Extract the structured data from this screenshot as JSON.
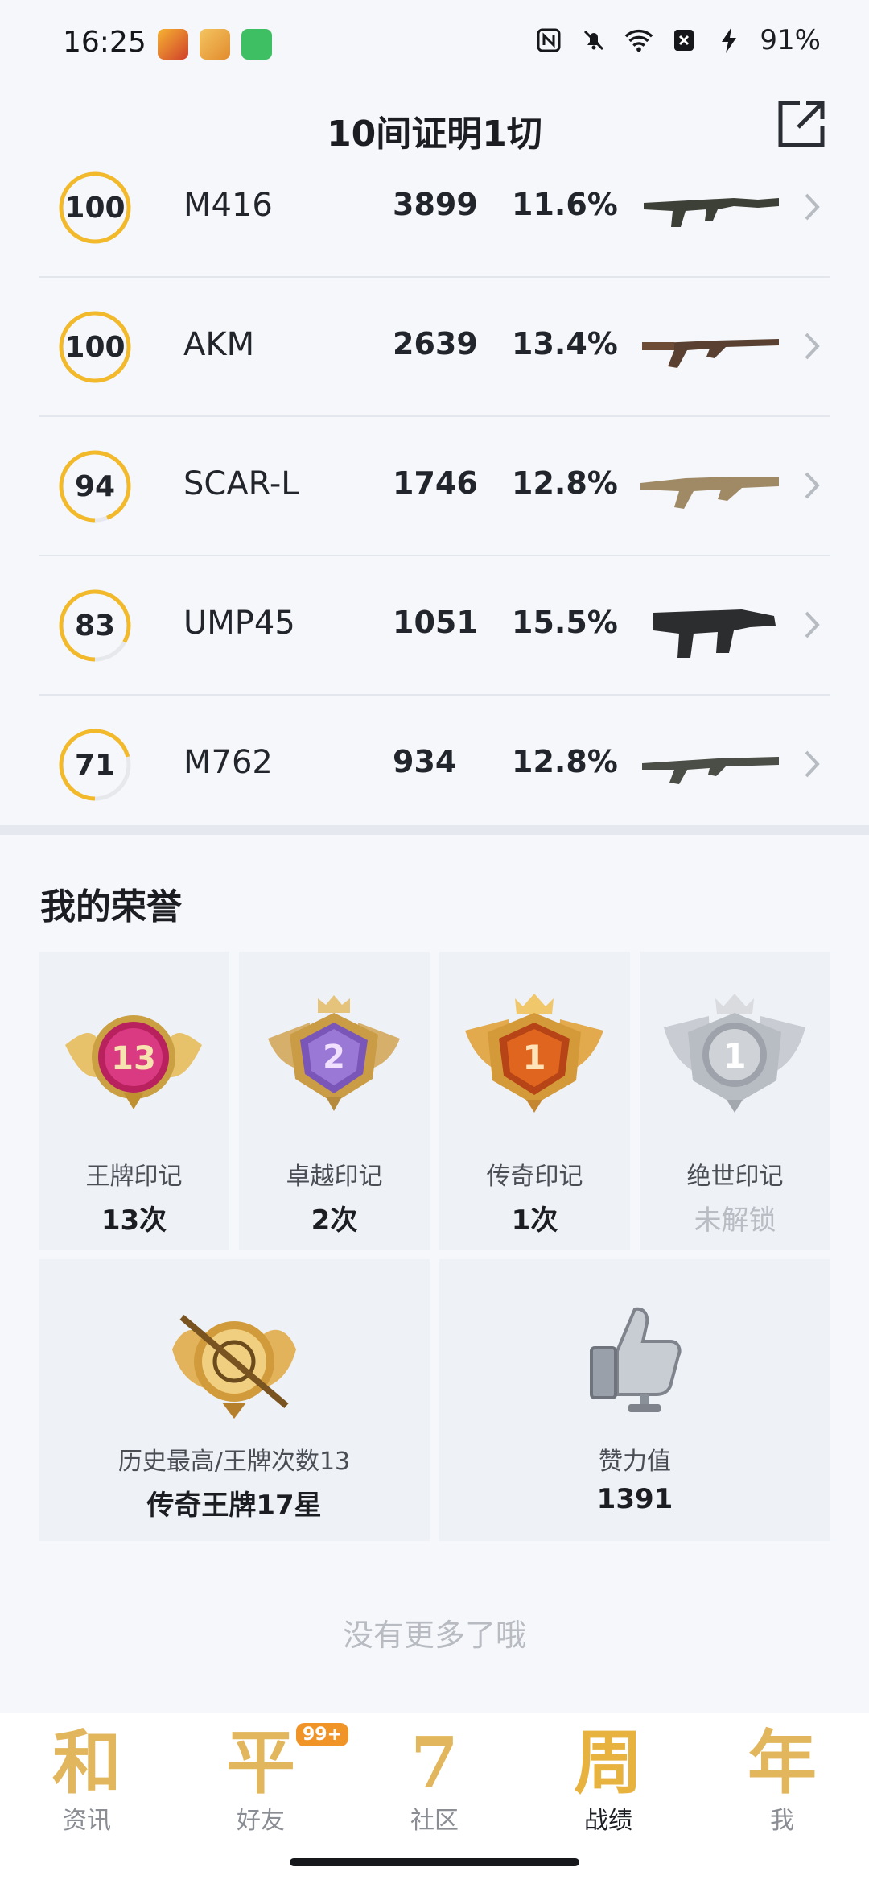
{
  "status": {
    "time": "16:25",
    "battery": "91%"
  },
  "header": {
    "title": "10间证明1切"
  },
  "weapons": [
    {
      "score": "100",
      "score_value": 100,
      "name": "M416",
      "kills": "3899",
      "pct": "11.6%"
    },
    {
      "score": "100",
      "score_value": 100,
      "name": "AKM",
      "kills": "2639",
      "pct": "13.4%"
    },
    {
      "score": "94",
      "score_value": 94,
      "name": "SCAR-L",
      "kills": "1746",
      "pct": "12.8%"
    },
    {
      "score": "83",
      "score_value": 83,
      "name": "UMP45",
      "kills": "1051",
      "pct": "15.5%"
    },
    {
      "score": "71",
      "score_value": 71,
      "name": "M762",
      "kills": "934",
      "pct": "12.8%"
    }
  ],
  "honors": {
    "title": "我的荣誉",
    "marks": [
      {
        "label": "王牌印记",
        "value": "13次",
        "badge_number": "13"
      },
      {
        "label": "卓越印记",
        "value": "2次",
        "badge_number": "2"
      },
      {
        "label": "传奇印记",
        "value": "1次",
        "badge_number": "1"
      },
      {
        "label": "绝世印记",
        "value": "未解锁",
        "badge_number": "1"
      }
    ],
    "history": {
      "label": "历史最高/王牌次数13",
      "value": "传奇王牌17星"
    },
    "likes": {
      "label": "赞力值",
      "value": "1391"
    }
  },
  "footer": {
    "note": "没有更多了哦"
  },
  "tabs": [
    {
      "icon": "和",
      "label": "资讯"
    },
    {
      "icon": "平",
      "label": "好友",
      "badge": "99+"
    },
    {
      "icon": "7",
      "label": "社区"
    },
    {
      "icon": "周",
      "label": "战绩"
    },
    {
      "icon": "年",
      "label": "我"
    }
  ],
  "colors": {
    "accent": "#f2b92a",
    "ring_track": "#e6e8ec",
    "badge": "#f19427"
  }
}
